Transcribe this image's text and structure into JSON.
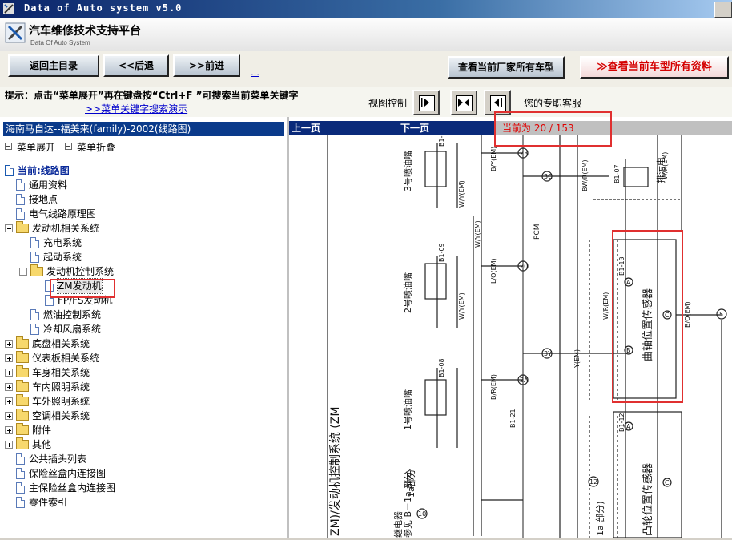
{
  "window": {
    "title": "Data of Auto system v5.0"
  },
  "header": {
    "title": "汽车维修技术支持平台",
    "subtitle": "Data Of Auto System"
  },
  "toolbar": {
    "back_home": "返回主目录",
    "back": "<<后退",
    "forward": ">>前进",
    "dots": "…",
    "view_all_maker": "查看当前厂家所有车型",
    "view_all_model": "≫查看当前车型所有资料"
  },
  "hint": {
    "text": "提示：点击“菜单展开”再在键盘按“Ctrl+F ”可搜索当前菜单关键字",
    "demo_link": ">>菜单关键字搜索演示",
    "view_control": "视图控制",
    "service": "您的专职客服"
  },
  "left": {
    "car_title": "海南马自达--福美来(family)-2002(线路图)",
    "expand": "菜单展开",
    "collapse": "菜单折叠",
    "tree": [
      {
        "label": "当前:线路图",
        "kind": "root"
      },
      {
        "label": "通用资料",
        "kind": "doc"
      },
      {
        "label": "接地点",
        "kind": "doc"
      },
      {
        "label": "电气线路原理图",
        "kind": "doc"
      },
      {
        "label": "发动机相关系统",
        "kind": "folder-open"
      },
      {
        "label": "充电系统",
        "kind": "doc"
      },
      {
        "label": "起动系统",
        "kind": "doc"
      },
      {
        "label": "发动机控制系统",
        "kind": "folder-open"
      },
      {
        "label": "ZM发动机",
        "kind": "doc"
      },
      {
        "label": "FP/FS发动机",
        "kind": "doc"
      },
      {
        "label": "燃油控制系统",
        "kind": "doc"
      },
      {
        "label": "冷却风扇系统",
        "kind": "doc"
      },
      {
        "label": "底盘相关系统",
        "kind": "folder"
      },
      {
        "label": "仪表板相关系统",
        "kind": "folder"
      },
      {
        "label": "车身相关系统",
        "kind": "folder"
      },
      {
        "label": "车内照明系统",
        "kind": "folder"
      },
      {
        "label": "车外照明系统",
        "kind": "folder"
      },
      {
        "label": "空调相关系统",
        "kind": "folder"
      },
      {
        "label": "附件",
        "kind": "folder"
      },
      {
        "label": "其他",
        "kind": "folder"
      },
      {
        "label": "公共插头列表",
        "kind": "doc"
      },
      {
        "label": "保险丝盒内连接图",
        "kind": "doc"
      },
      {
        "label": "主保险丝盒内连接图",
        "kind": "doc"
      },
      {
        "label": "零件索引",
        "kind": "doc"
      }
    ]
  },
  "right": {
    "prev_page": "上一页",
    "next_page": "下一页",
    "current_page": "当前为  20 / 153"
  },
  "diagram": {
    "labels": {
      "inj3": "3号喷油嘴",
      "inj2": "2号喷油嘴",
      "inj1": "1号喷油嘴",
      "system": "ZM)/发动机控制系统 (ZM",
      "sub": "1a部分",
      "sub2": "1a 部分)",
      "relay": "继电器",
      "see": "参见 B－1a 部分",
      "pcm": "PCM",
      "exhaust": "排污电",
      "crank": "曲轴位置传感器",
      "cam": "凸轮位置传感器",
      "b101": "B1-",
      "b109": "B1-09",
      "b108": "B1-08",
      "b107": "B1-07",
      "b113": "B1-13",
      "b112": "B1-12",
      "b121": "B1-21",
      "by_em": "B/Y(EM)",
      "wy_em": "W/Y(EM)",
      "lo_em": "L/O(EM)",
      "br_em": "B/R(EM)",
      "wr_em": "W/R(EM)",
      "bwr_em": "BW/R(EM)",
      "bo_em": "B/O(EM)",
      "y_em": "Y(EM)",
      "pin23": "23",
      "pin20": "20",
      "pin2a": "2A",
      "pin3c": "3C",
      "pin3y": "3Y",
      "pin5": "5",
      "pin10": "10",
      "pin12": "12",
      "pa": "A",
      "pb": "B",
      "pc": "C"
    }
  }
}
